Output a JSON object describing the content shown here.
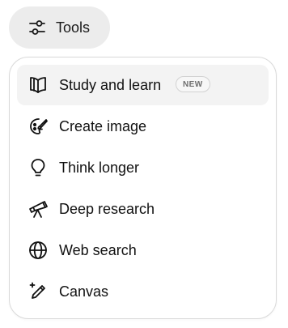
{
  "tools_button": {
    "label": "Tools",
    "icon": "sliders-icon"
  },
  "menu": {
    "items": [
      {
        "label": "Study and learn",
        "icon": "open-book-icon",
        "badge": "NEW",
        "highlighted": true
      },
      {
        "label": "Create image",
        "icon": "palette-brush-icon"
      },
      {
        "label": "Think longer",
        "icon": "lightbulb-icon"
      },
      {
        "label": "Deep research",
        "icon": "telescope-icon"
      },
      {
        "label": "Web search",
        "icon": "globe-icon"
      },
      {
        "label": "Canvas",
        "icon": "pencil-sparkle-icon"
      }
    ]
  }
}
